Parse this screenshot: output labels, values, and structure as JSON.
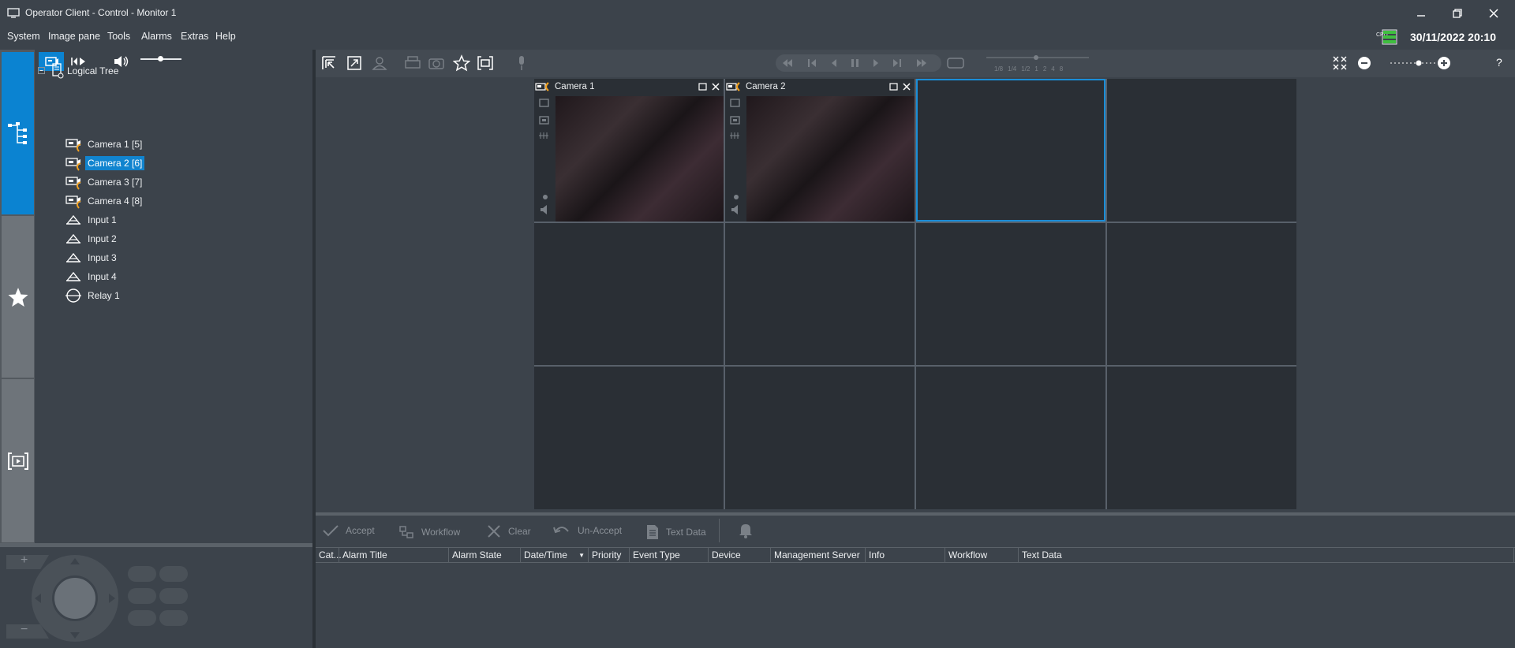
{
  "window": {
    "title": "Operator Client - Control - Monitor 1",
    "minimize_icon": "minimize-icon",
    "restore_icon": "restore-icon",
    "close_icon": "close-icon"
  },
  "menu": {
    "items": [
      "System",
      "Image pane",
      "Tools",
      "Alarms",
      "Extras",
      "Help"
    ],
    "datetime": "30/11/2022 20:10",
    "cpu_label": "CPU"
  },
  "tree": {
    "root": "Logical Tree",
    "items": [
      {
        "label": "Camera 1 [5]",
        "type": "camera",
        "selected": false
      },
      {
        "label": "Camera 2 [6]",
        "type": "camera",
        "selected": true
      },
      {
        "label": "Camera 3 [7]",
        "type": "camera",
        "selected": false
      },
      {
        "label": "Camera 4 [8]",
        "type": "camera",
        "selected": false
      },
      {
        "label": "Input 1",
        "type": "input",
        "selected": false
      },
      {
        "label": "Input 2",
        "type": "input",
        "selected": false
      },
      {
        "label": "Input 3",
        "type": "input",
        "selected": false
      },
      {
        "label": "Input 4",
        "type": "input",
        "selected": false
      },
      {
        "label": "Relay 1",
        "type": "relay",
        "selected": false
      }
    ]
  },
  "playback": {
    "speeds": [
      "1/8",
      "1/4",
      "1/2",
      "1",
      "2",
      "4",
      "8"
    ]
  },
  "image_pane": {
    "cells": [
      {
        "title": "Camera 1",
        "has_video": true
      },
      {
        "title": "Camera 2",
        "has_video": true
      },
      {
        "title": "",
        "has_video": false,
        "active": true
      },
      {
        "title": "",
        "has_video": false
      },
      {
        "title": "",
        "has_video": false
      },
      {
        "title": "",
        "has_video": false
      },
      {
        "title": "",
        "has_video": false
      },
      {
        "title": "",
        "has_video": false
      },
      {
        "title": "",
        "has_video": false
      },
      {
        "title": "",
        "has_video": false
      },
      {
        "title": "",
        "has_video": false
      },
      {
        "title": "",
        "has_video": false
      }
    ]
  },
  "alarm_toolbar": {
    "accept": "Accept",
    "workflow": "Workflow",
    "clear": "Clear",
    "unaccept": "Un-Accept",
    "text_data": "Text Data"
  },
  "alarm_columns": [
    "Cat...",
    "Alarm Title",
    "Alarm State",
    "Date/Time",
    "Priority",
    "Event Type",
    "Device",
    "Management Server",
    "Info",
    "Workflow",
    "Text Data"
  ],
  "ptz": {
    "zoom_in": "+",
    "zoom_out": "−"
  },
  "colors": {
    "accent": "#0b83d1",
    "background": "#3c434b",
    "camera_alarm": "#f0a020"
  },
  "help_label": "?"
}
